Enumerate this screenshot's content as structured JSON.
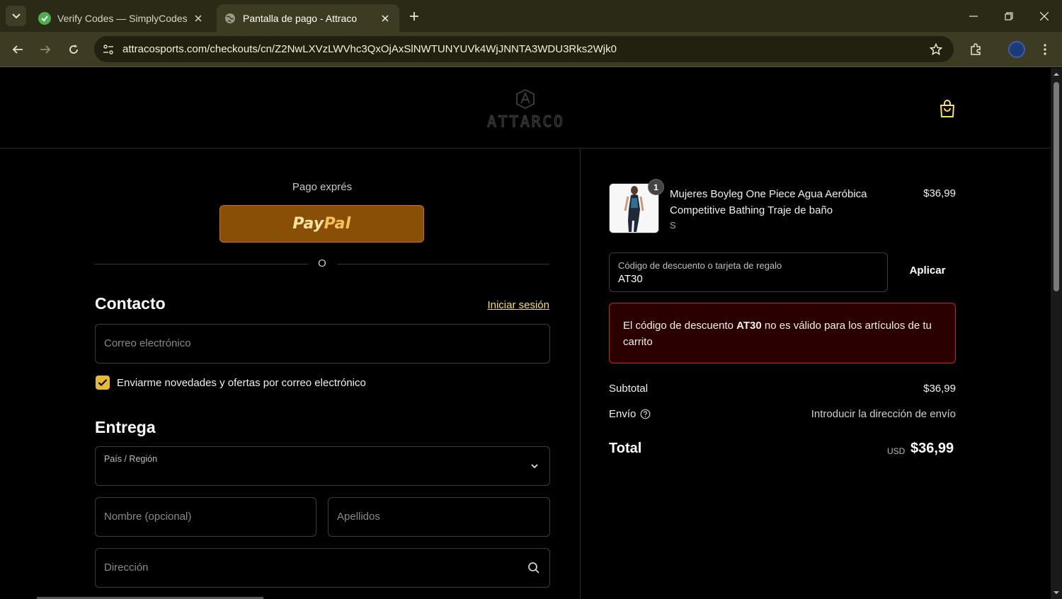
{
  "browser": {
    "tabs": [
      {
        "title": "Verify Codes — SimplyCodes",
        "favicon": "simplycodes-icon",
        "active": false
      },
      {
        "title": "Pantalla de pago - Attraco",
        "favicon": "globe-icon",
        "active": true
      }
    ],
    "url": "attracosports.com/checkouts/cn/Z2NwLXVzLWVhc3QxOjAxSlNWTUNYUVk4WjJNNTA3WDU3Rks2Wjk0"
  },
  "header": {
    "logo_text": "ATTARCO",
    "cart_icon": "shopping-bag-icon"
  },
  "checkout": {
    "express_label": "Pago exprés",
    "paypal_label": "PayPal",
    "or_text": "O",
    "contact": {
      "heading": "Contacto",
      "login_link": "Iniciar sesión",
      "email_placeholder": "Correo electrónico",
      "newsletter_label": "Enviarme novedades y ofertas por correo electrónico",
      "newsletter_checked": true
    },
    "delivery": {
      "heading": "Entrega",
      "country_label": "País / Región",
      "country_value": "",
      "first_name_placeholder": "Nombre (opcional)",
      "last_name_placeholder": "Apellidos",
      "address_placeholder": "Dirección"
    }
  },
  "summary": {
    "product": {
      "name": "Mujeres Boyleg One Piece Agua Aeróbica Competitive Bathing Traje de baño",
      "variant": "S",
      "price": "$36,99",
      "quantity": "1"
    },
    "discount": {
      "label": "Código de descuento o tarjeta de regalo",
      "value": "AT30",
      "apply_label": "Aplicar"
    },
    "error": {
      "prefix": "El código de descuento ",
      "code": "AT30",
      "suffix": " no es válido para los artículos de tu carrito"
    },
    "subtotal_label": "Subtotal",
    "subtotal_value": "$36,99",
    "shipping_label": "Envío",
    "shipping_value": "Introducir la dirección de envío",
    "total_label": "Total",
    "total_currency": "USD",
    "total_value": "$36,99"
  },
  "colors": {
    "accent": "#e8b935",
    "paypal_bg": "#8a4f06",
    "error_border": "#c2262b",
    "error_bg": "#2a0000",
    "link": "#f5e15a"
  }
}
